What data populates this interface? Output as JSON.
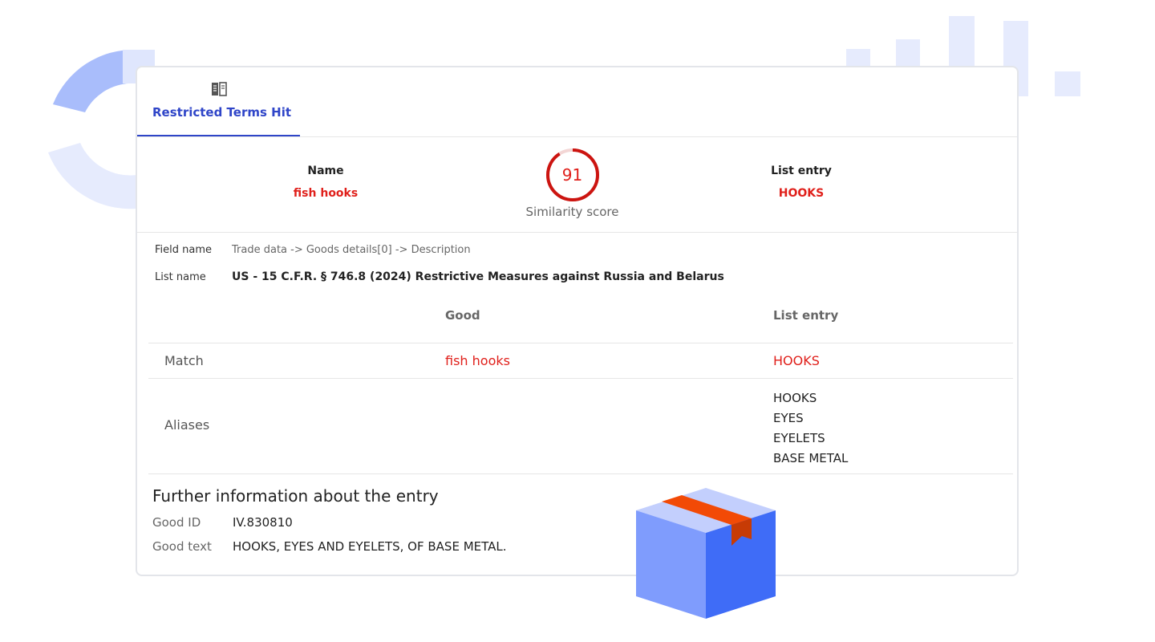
{
  "tab": {
    "label": "Restricted Terms Hit",
    "icon": "book-icon"
  },
  "summary": {
    "name_header": "Name",
    "name_value": "fish hooks",
    "score": "91",
    "score_label": "Similarity score",
    "score_fraction": 0.91,
    "list_entry_header": "List entry",
    "list_entry_value": "HOOKS"
  },
  "meta": {
    "field_name_label": "Field name",
    "field_name_value": "Trade data -> Goods details[0] -> Description",
    "list_name_label": "List name",
    "list_name_value": "US - 15 C.F.R. § 746.8 (2024) Restrictive Measures against Russia and Belarus"
  },
  "table": {
    "col_good": "Good",
    "col_list_entry": "List entry",
    "match_label": "Match",
    "match_good": "fish hooks",
    "match_entry": "HOOKS",
    "aliases_label": "Aliases",
    "aliases": [
      "HOOKS",
      "EYES",
      "EYELETS",
      "BASE METAL"
    ]
  },
  "further": {
    "title": "Further information about the entry",
    "good_id_label": "Good ID",
    "good_id_value": "IV.830810",
    "good_text_label": "Good text",
    "good_text_value": "HOOKS, EYES AND EYELETS, OF BASE METAL."
  },
  "colors": {
    "accent": "#2f45c8",
    "alert": "#e0201b",
    "deco_blue": "#3f6cf7"
  }
}
